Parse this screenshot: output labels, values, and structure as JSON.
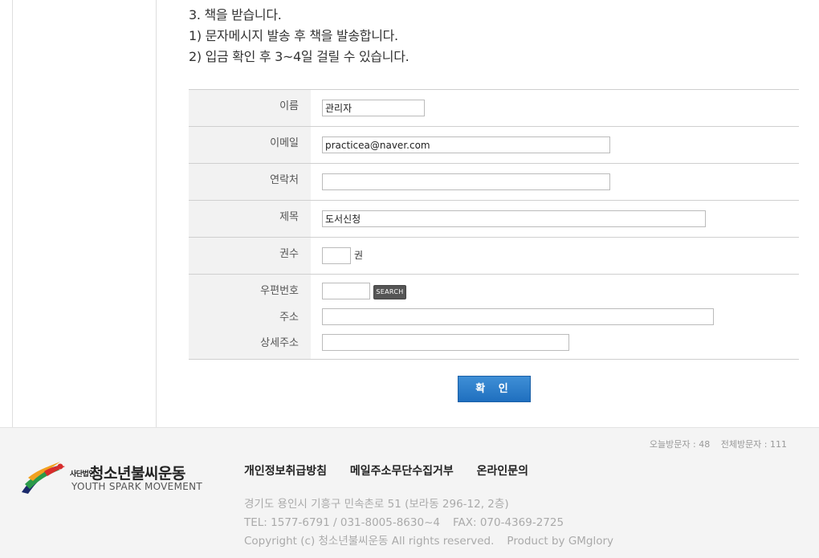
{
  "instructions": [
    "3. 책을 받습니다.",
    "1) 문자메시지 발송 후 책을 발송합니다.",
    "2) 입금 확인 후 3~4일 걸릴 수 있습니다."
  ],
  "form": {
    "name_label": "이름",
    "name_value": "관리자",
    "email_label": "이메일",
    "email_value": "practicea@naver.com",
    "phone_label": "연락처",
    "phone_value": "",
    "subject_label": "제목",
    "subject_value": "도서신청",
    "quantity_label": "권수",
    "quantity_value": "",
    "quantity_unit": "권",
    "zip_label": "우편번호",
    "zip_value": "",
    "search_button": "SEARCH",
    "address_label": "주소",
    "address_value": "",
    "detail_address_label": "상세주소",
    "detail_address_value": "",
    "confirm_button": "확 인"
  },
  "footer": {
    "visits_today": "오늘방문자 : 48",
    "visits_total": "전체방문자 : 111",
    "logo_corp": "사단법인",
    "logo_name": "청소년불씨운동",
    "logo_english": "YOUTH SPARK MOVEMENT",
    "links": [
      "개인정보취급방침",
      "메일주소무단수집거부",
      "온라인문의"
    ],
    "address": "경기도 용인시 기흥구 민속촌로 51 (보라동 296-12, 2층)",
    "tel": "TEL: 1577-6791 / 031-8005-8630~4",
    "fax": "FAX: 070-4369-2725",
    "copyright": "Copyright (c) 청소년불씨운동 All rights reserved.",
    "product_by": "Product by GMglory"
  },
  "colors": {
    "confirm_button": "#2a7bcb",
    "label_bg": "#f2f2f2",
    "footer_bg": "#f4f4f4"
  }
}
